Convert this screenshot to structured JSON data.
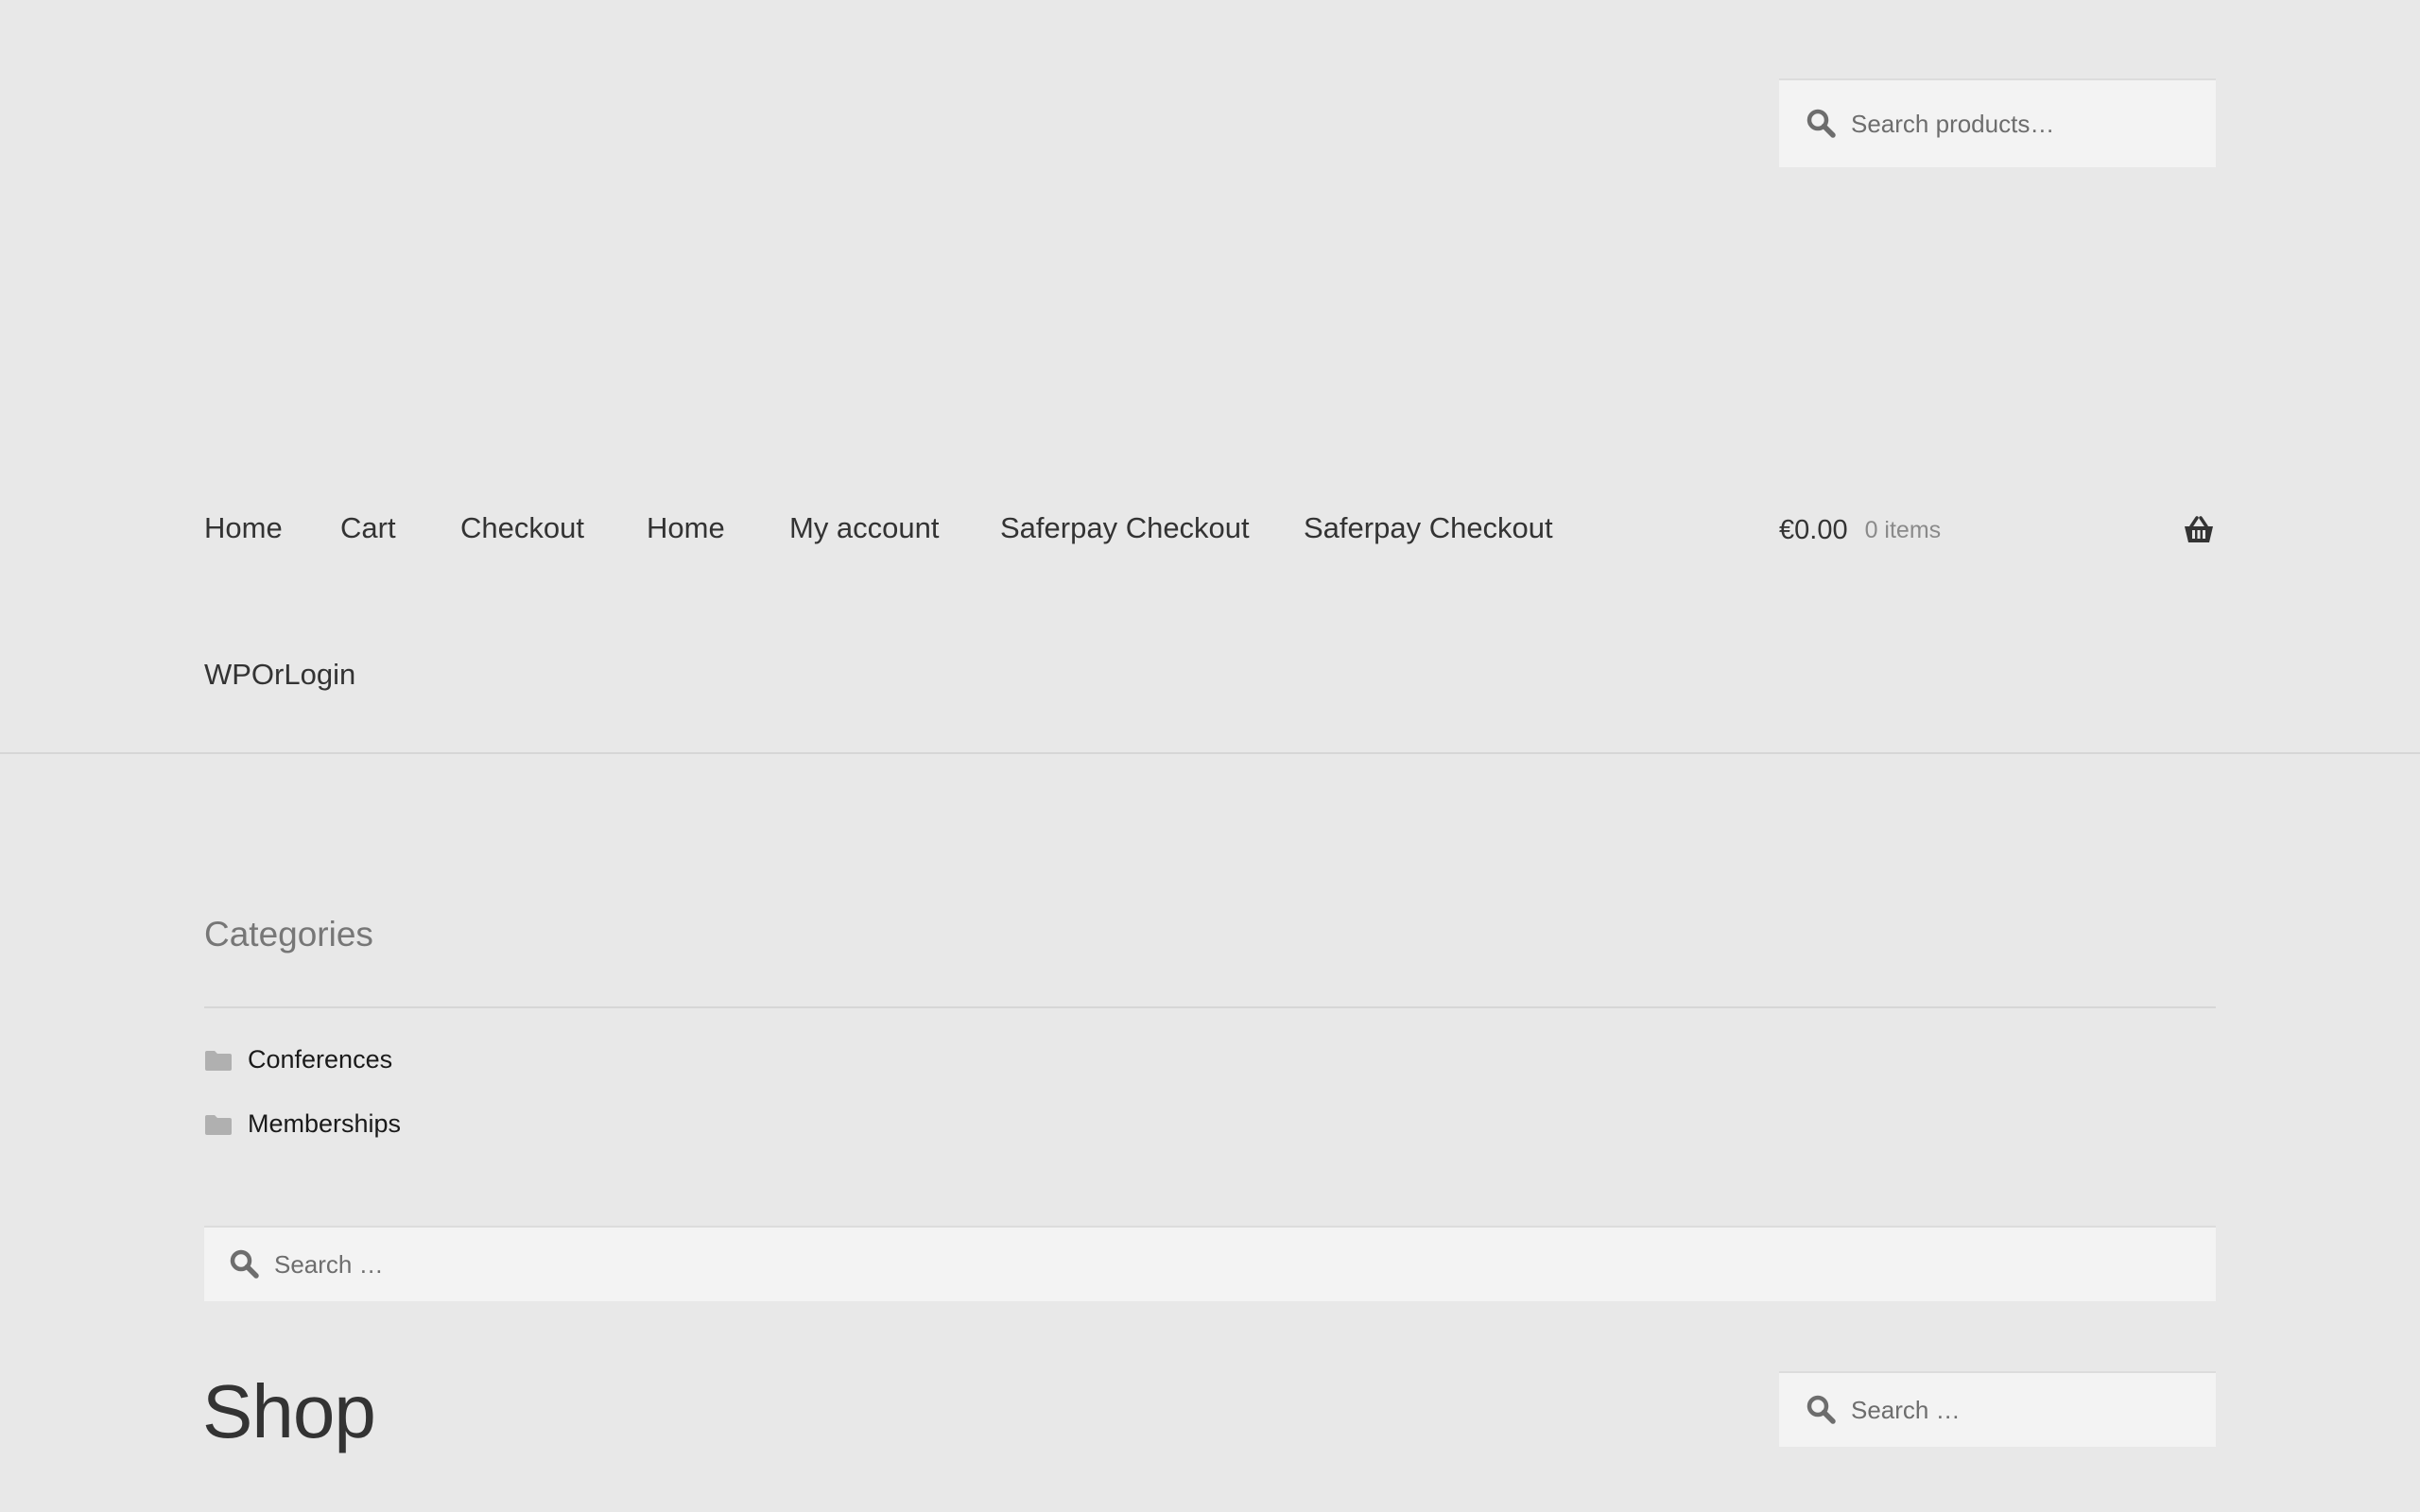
{
  "header": {
    "product_search": {
      "placeholder": "Search products…",
      "icon": "search-icon"
    }
  },
  "nav": {
    "items": [
      {
        "label": "Home"
      },
      {
        "label": "Cart"
      },
      {
        "label": "Checkout"
      },
      {
        "label": "Home"
      },
      {
        "label": "My account"
      },
      {
        "label": "Saferpay Checkout"
      },
      {
        "label": "Saferpay Checkout"
      },
      {
        "label": "WPOrLogin"
      }
    ]
  },
  "cart": {
    "total": "€0.00",
    "count": "0 items",
    "icon": "basket-icon"
  },
  "widgets": {
    "categories": {
      "title": "Categories",
      "items": [
        {
          "label": "Conferences",
          "icon": "folder-icon"
        },
        {
          "label": "Memberships",
          "icon": "folder-icon"
        }
      ]
    },
    "search": {
      "placeholder": "Search …",
      "icon": "search-icon"
    }
  },
  "main": {
    "title": "Shop",
    "search": {
      "placeholder": "Search …",
      "icon": "search-icon"
    }
  },
  "colors": {
    "background": "#e8e8e8",
    "input_background": "#f3f3f3",
    "text": "#333333",
    "muted": "#8a8a8a",
    "icon": "#6d6d6d"
  }
}
